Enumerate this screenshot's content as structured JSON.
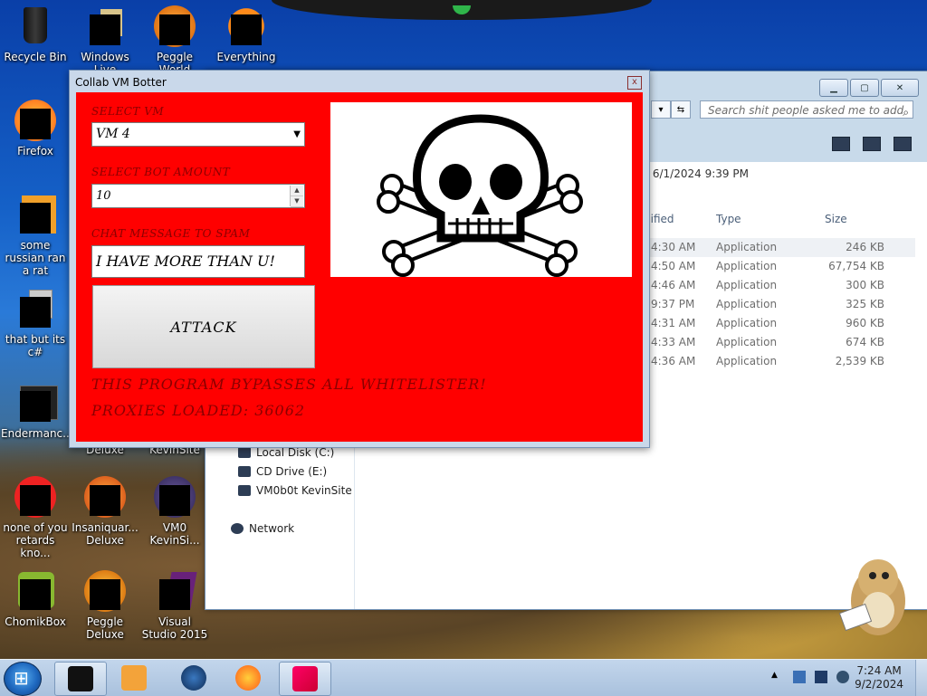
{
  "desktop": {
    "icons": [
      {
        "label": "Recycle Bin"
      },
      {
        "label": "Windows Live"
      },
      {
        "label": "Peggle World"
      },
      {
        "label": "Everything"
      },
      {
        "label": "Firefox"
      },
      {
        "label": "some russian ran a rat"
      },
      {
        "label": "that but its c#"
      },
      {
        "label": "Endermanc..."
      },
      {
        "label": "Deluxe"
      },
      {
        "label": "KevinSite"
      },
      {
        "label": "none of you retards kno..."
      },
      {
        "label": "Insaniquar... Deluxe"
      },
      {
        "label": "VM0 KevinSi..."
      },
      {
        "label": "ChomikBox"
      },
      {
        "label": "Peggle Deluxe"
      },
      {
        "label": "Visual Studio 2015"
      }
    ]
  },
  "explorer": {
    "search_placeholder": "Search shit people asked me to add",
    "modified": "6/1/2024 9:39 PM",
    "columns": {
      "modified": "dified",
      "type": "Type",
      "size": "Size"
    },
    "files": [
      {
        "time": "4:30 AM",
        "type": "Application",
        "size": "246 KB"
      },
      {
        "time": "4:50 AM",
        "type": "Application",
        "size": "67,754 KB"
      },
      {
        "time": "4:46 AM",
        "type": "Application",
        "size": "300 KB"
      },
      {
        "time": "9:37 PM",
        "type": "Application",
        "size": "325 KB"
      },
      {
        "time": "4:31 AM",
        "type": "Application",
        "size": "960 KB"
      },
      {
        "time": "4:33 AM",
        "type": "Application",
        "size": "674 KB"
      },
      {
        "time": "4:36 AM",
        "type": "Application",
        "size": "2,539 KB"
      }
    ],
    "nav": {
      "local_disk": "Local Disk (C:)",
      "cd_drive": "CD Drive (E:)",
      "vm_site": "VM0b0t KevinSite",
      "network": "Network"
    }
  },
  "botter": {
    "title": "Collab VM Botter",
    "close": "x",
    "select_vm_label": "SELECT VM",
    "vm_value": "VM 4",
    "bot_amount_label": "SELECT BOT AMOUNT",
    "bot_amount_value": "10",
    "chat_label": "CHAT MESSAGE TO SPAM",
    "chat_value": "I HAVE MORE THAN U!",
    "attack_label": "ATTACK",
    "bypass_text": "THIS PROGRAM BYPASSES ALL WHITELISTER!",
    "proxies_text": "PROXIES LOADED: 36062"
  },
  "taskbar": {
    "time": "7:24 AM",
    "date": "9/2/2024"
  }
}
